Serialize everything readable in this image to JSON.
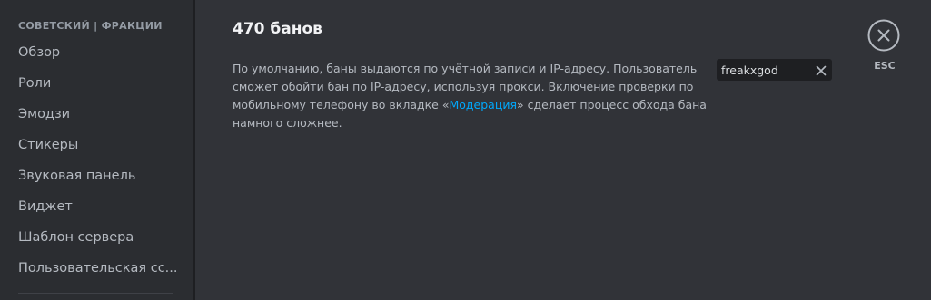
{
  "sidebar": {
    "header": "СОВЕТСКИЙ | ФРАКЦИИ",
    "items": [
      {
        "label": "Обзор"
      },
      {
        "label": "Роли"
      },
      {
        "label": "Эмодзи"
      },
      {
        "label": "Стикеры"
      },
      {
        "label": "Звуковая панель"
      },
      {
        "label": "Виджет"
      },
      {
        "label": "Шаблон сервера"
      },
      {
        "label": "Пользовательская сс..."
      }
    ]
  },
  "main": {
    "title": "470 банов",
    "description": {
      "line1": "По умолчанию, баны выдаются по учётной записи и IP-адресу. Пользователь",
      "line2": "сможет обойти бан по IP-адресу, используя прокси. Включение проверки по",
      "line3_before": "мобильному телефону во вкладке «",
      "link": "Модерация",
      "line3_after": "» сделает процесс обхода бана",
      "line4": "намного сложнее."
    },
    "search": {
      "value": "freakxgod"
    }
  },
  "close": {
    "esc_label": "ESC"
  },
  "colors": {
    "background": "#313338",
    "sidebar": "#2b2d31",
    "link": "#00a8fc",
    "title": "#f2f3f5",
    "text": "#b5bac1"
  },
  "icons": {
    "clear": "close-x-icon",
    "close": "close-circle-icon"
  }
}
